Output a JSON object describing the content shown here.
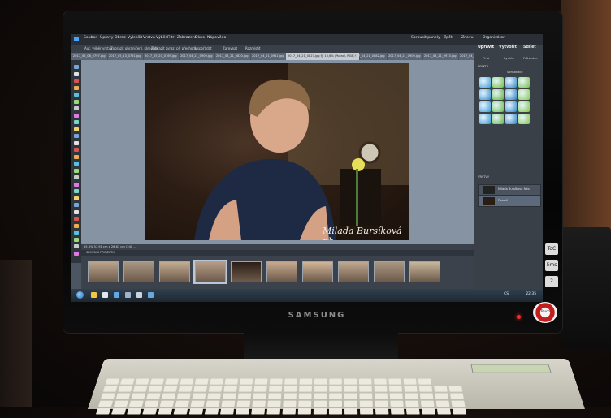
{
  "app": {
    "menu": [
      "Soubor",
      "Úpravy",
      "Obraz",
      "Vylepšit",
      "Vrstva",
      "Výběr",
      "Filtr",
      "Zobrazení",
      "Okno",
      "Nápověda"
    ],
    "right_menu": [
      "Sbrousit panely",
      "Zpět",
      "Znovu",
      "Organizátor"
    ],
    "options": [
      "Aut. výběr vrstvy",
      "Zobrazit ohraničení, rámeček",
      "Zobrazit zvraz. při přechodu",
      "Uspořádat",
      "Zarovnat",
      "Rozmístit"
    ],
    "file_tabs": [
      "2017_05_06_0797.jpg",
      "2017_05_13_0751.jpg",
      "2017_05_20_0769.jpg",
      "2017_04_21_0909.jpg",
      "2017_04_21_0820.jpg",
      "2017_04_21_0911.jpg",
      "2017_04_21_0827.jpg @ 15,6% (Pozadí, RGB/8)",
      "2017_04_21_0882.jpg",
      "2017_04_21_0909.jpg",
      "2017_04_21_0913.jpg",
      "2017_04_21_0904.jpg",
      "2017_04_21_0861.jpg"
    ],
    "active_tab_index": 6,
    "status": "15,6%   37,91 cm x 26,61 cm (240 ...",
    "bin_title": "SEMENÍK PROJEKTU",
    "bin_dropdown": "Zobrazit otevřené soubory",
    "signature": "Milada Bursíková  ph.",
    "panel_tabs": [
      "Upravit",
      "Vytvořit",
      "Sdílet"
    ],
    "panel_subtabs": [
      "Plná",
      "Rychlá",
      "Průvodce"
    ],
    "effects_title": "EFEKTY",
    "effects_dropdown": "Sofistikace",
    "layers_title": "VRSTVY",
    "layers": [
      {
        "label": "Milada Bursíková foto"
      },
      {
        "label": "Pozadí"
      }
    ],
    "clock": "22:35",
    "lang": "CS",
    "thumbnails": 10,
    "selected_thumb": 3
  },
  "monitor": {
    "brand": "SAMSUNG",
    "badges": [
      "ToC",
      "5ms",
      "2"
    ],
    "sticker": "Touch"
  },
  "colors": {
    "effect_tiles": [
      "#3f9fd6",
      "#6fbf3a",
      "#2f86c9",
      "#7ac143",
      "#338dd0",
      "#5fb43a",
      "#2a7fc3",
      "#8acb4e",
      "#3b98d3",
      "#66bb44",
      "#2d86c8",
      "#7cc548",
      "#3594d1",
      "#5eb63c",
      "#2b82c6",
      "#83c74b"
    ]
  }
}
